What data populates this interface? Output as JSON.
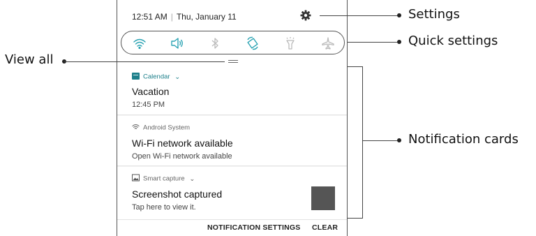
{
  "status_bar": {
    "time": "12:51 AM",
    "date": "Thu, January 11"
  },
  "quick_settings": {
    "icons": [
      "wifi-icon",
      "sound-icon",
      "bluetooth-icon",
      "auto-rotate-icon",
      "flashlight-icon",
      "airplane-mode-icon"
    ]
  },
  "notifications": [
    {
      "app": "Calendar",
      "title": "Vacation",
      "body": "12:45 PM",
      "app_color": "#1c7f8a"
    },
    {
      "app": "Android System",
      "title": "Wi-Fi network available",
      "body": "Open Wi-Fi network available"
    },
    {
      "app": "Smart capture",
      "title": "Screenshot captured",
      "body": "Tap here to view it."
    }
  ],
  "footer": {
    "settings_label": "NOTIFICATION SETTINGS",
    "clear_label": "CLEAR"
  },
  "callouts": {
    "settings": "Settings",
    "quick_settings": "Quick settings",
    "view_all": "View all",
    "notification_cards": "Notification cards"
  },
  "colors": {
    "accent": "#1c7f8a",
    "qs_icon": "#2aa3b3",
    "inactive_icon": "#bbbbbb"
  }
}
